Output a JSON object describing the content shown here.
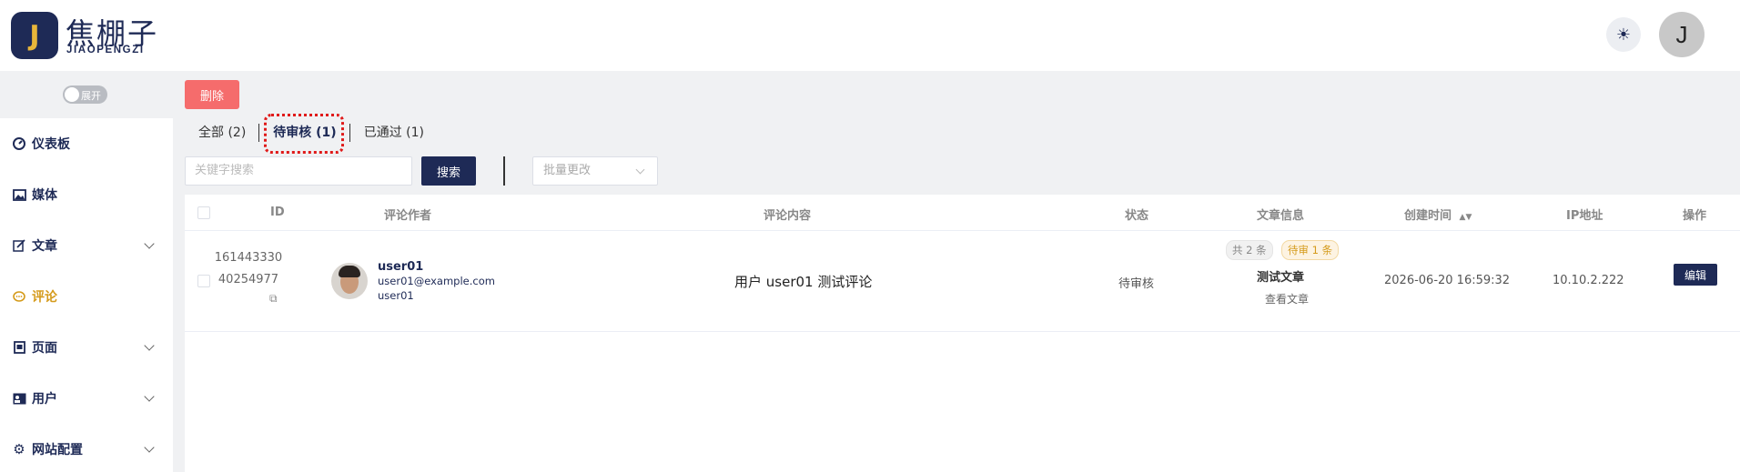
{
  "header": {
    "logo_letter": "J",
    "logo_cn": "焦棚子",
    "logo_en": "JIAOPENGZI",
    "theme_icon": "sun-icon",
    "avatar_letter": "J"
  },
  "sidebar": {
    "toggle_label": "展开",
    "items": [
      {
        "label": "仪表板",
        "icon": "dashboard-icon",
        "has_submenu": false
      },
      {
        "label": "媒体",
        "icon": "image-icon",
        "has_submenu": false
      },
      {
        "label": "文章",
        "icon": "edit-icon",
        "has_submenu": true
      },
      {
        "label": "评论",
        "icon": "comment-icon",
        "has_submenu": false,
        "active": true
      },
      {
        "label": "页面",
        "icon": "page-icon",
        "has_submenu": true
      },
      {
        "label": "用户",
        "icon": "user-icon",
        "has_submenu": true
      },
      {
        "label": "网站配置",
        "icon": "gear-icon",
        "has_submenu": true
      }
    ]
  },
  "toolbar": {
    "delete_label": "删除",
    "search_placeholder": "关键字搜索",
    "search_label": "搜索",
    "bulk_placeholder": "批量更改"
  },
  "tabs": [
    {
      "label": "全部 (2)"
    },
    {
      "label": "待审核 (1)",
      "active": true
    },
    {
      "label": "已通过 (1)"
    }
  ],
  "table": {
    "columns": [
      "ID",
      "评论作者",
      "评论内容",
      "状态",
      "文章信息",
      "创建时间",
      "IP地址",
      "操作"
    ],
    "rows": [
      {
        "id_line1": "161443330",
        "id_line2": "40254977",
        "author_name": "user01",
        "author_email": "user01@example.com",
        "author_username": "user01",
        "content": "用户 user01 测试评论",
        "status": "待审核",
        "tag_total": "共 2 条",
        "tag_pending": "待审 1 条",
        "article_title": "测试文章",
        "view_article": "查看文章",
        "created_at": "2026-06-20 16:59:32",
        "ip": "10.10.2.222",
        "edit_label": "编辑"
      }
    ]
  },
  "colors": {
    "brand": "#1e2a56",
    "accent": "#d59b1c",
    "danger": "#f56c6c"
  }
}
